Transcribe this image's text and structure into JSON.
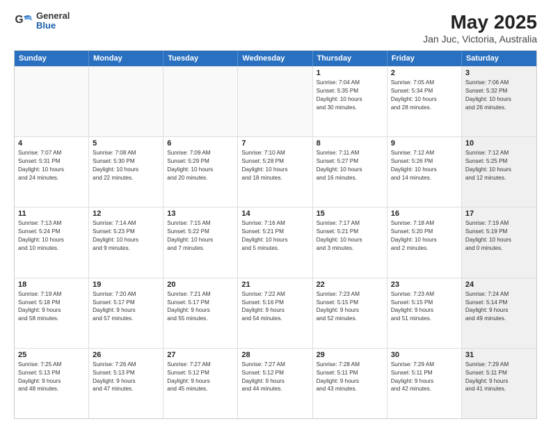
{
  "logo": {
    "general": "General",
    "blue": "Blue"
  },
  "title": "May 2025",
  "subtitle": "Jan Juc, Victoria, Australia",
  "days": [
    "Sunday",
    "Monday",
    "Tuesday",
    "Wednesday",
    "Thursday",
    "Friday",
    "Saturday"
  ],
  "weeks": [
    [
      {
        "day": "",
        "info": "",
        "empty": true
      },
      {
        "day": "",
        "info": "",
        "empty": true
      },
      {
        "day": "",
        "info": "",
        "empty": true
      },
      {
        "day": "",
        "info": "",
        "empty": true
      },
      {
        "day": "1",
        "info": "Sunrise: 7:04 AM\nSunset: 5:35 PM\nDaylight: 10 hours\nand 30 minutes."
      },
      {
        "day": "2",
        "info": "Sunrise: 7:05 AM\nSunset: 5:34 PM\nDaylight: 10 hours\nand 28 minutes."
      },
      {
        "day": "3",
        "info": "Sunrise: 7:06 AM\nSunset: 5:32 PM\nDaylight: 10 hours\nand 26 minutes.",
        "shaded": true
      }
    ],
    [
      {
        "day": "4",
        "info": "Sunrise: 7:07 AM\nSunset: 5:31 PM\nDaylight: 10 hours\nand 24 minutes."
      },
      {
        "day": "5",
        "info": "Sunrise: 7:08 AM\nSunset: 5:30 PM\nDaylight: 10 hours\nand 22 minutes."
      },
      {
        "day": "6",
        "info": "Sunrise: 7:09 AM\nSunset: 5:29 PM\nDaylight: 10 hours\nand 20 minutes."
      },
      {
        "day": "7",
        "info": "Sunrise: 7:10 AM\nSunset: 5:28 PM\nDaylight: 10 hours\nand 18 minutes."
      },
      {
        "day": "8",
        "info": "Sunrise: 7:11 AM\nSunset: 5:27 PM\nDaylight: 10 hours\nand 16 minutes."
      },
      {
        "day": "9",
        "info": "Sunrise: 7:12 AM\nSunset: 5:26 PM\nDaylight: 10 hours\nand 14 minutes."
      },
      {
        "day": "10",
        "info": "Sunrise: 7:12 AM\nSunset: 5:25 PM\nDaylight: 10 hours\nand 12 minutes.",
        "shaded": true
      }
    ],
    [
      {
        "day": "11",
        "info": "Sunrise: 7:13 AM\nSunset: 5:24 PM\nDaylight: 10 hours\nand 10 minutes."
      },
      {
        "day": "12",
        "info": "Sunrise: 7:14 AM\nSunset: 5:23 PM\nDaylight: 10 hours\nand 9 minutes."
      },
      {
        "day": "13",
        "info": "Sunrise: 7:15 AM\nSunset: 5:22 PM\nDaylight: 10 hours\nand 7 minutes."
      },
      {
        "day": "14",
        "info": "Sunrise: 7:16 AM\nSunset: 5:21 PM\nDaylight: 10 hours\nand 5 minutes."
      },
      {
        "day": "15",
        "info": "Sunrise: 7:17 AM\nSunset: 5:21 PM\nDaylight: 10 hours\nand 3 minutes."
      },
      {
        "day": "16",
        "info": "Sunrise: 7:18 AM\nSunset: 5:20 PM\nDaylight: 10 hours\nand 2 minutes."
      },
      {
        "day": "17",
        "info": "Sunrise: 7:19 AM\nSunset: 5:19 PM\nDaylight: 10 hours\nand 0 minutes.",
        "shaded": true
      }
    ],
    [
      {
        "day": "18",
        "info": "Sunrise: 7:19 AM\nSunset: 5:18 PM\nDaylight: 9 hours\nand 58 minutes."
      },
      {
        "day": "19",
        "info": "Sunrise: 7:20 AM\nSunset: 5:17 PM\nDaylight: 9 hours\nand 57 minutes."
      },
      {
        "day": "20",
        "info": "Sunrise: 7:21 AM\nSunset: 5:17 PM\nDaylight: 9 hours\nand 55 minutes."
      },
      {
        "day": "21",
        "info": "Sunrise: 7:22 AM\nSunset: 5:16 PM\nDaylight: 9 hours\nand 54 minutes."
      },
      {
        "day": "22",
        "info": "Sunrise: 7:23 AM\nSunset: 5:15 PM\nDaylight: 9 hours\nand 52 minutes."
      },
      {
        "day": "23",
        "info": "Sunrise: 7:23 AM\nSunset: 5:15 PM\nDaylight: 9 hours\nand 51 minutes."
      },
      {
        "day": "24",
        "info": "Sunrise: 7:24 AM\nSunset: 5:14 PM\nDaylight: 9 hours\nand 49 minutes.",
        "shaded": true
      }
    ],
    [
      {
        "day": "25",
        "info": "Sunrise: 7:25 AM\nSunset: 5:13 PM\nDaylight: 9 hours\nand 48 minutes."
      },
      {
        "day": "26",
        "info": "Sunrise: 7:26 AM\nSunset: 5:13 PM\nDaylight: 9 hours\nand 47 minutes."
      },
      {
        "day": "27",
        "info": "Sunrise: 7:27 AM\nSunset: 5:12 PM\nDaylight: 9 hours\nand 45 minutes."
      },
      {
        "day": "28",
        "info": "Sunrise: 7:27 AM\nSunset: 5:12 PM\nDaylight: 9 hours\nand 44 minutes."
      },
      {
        "day": "29",
        "info": "Sunrise: 7:28 AM\nSunset: 5:11 PM\nDaylight: 9 hours\nand 43 minutes."
      },
      {
        "day": "30",
        "info": "Sunrise: 7:29 AM\nSunset: 5:11 PM\nDaylight: 9 hours\nand 42 minutes."
      },
      {
        "day": "31",
        "info": "Sunrise: 7:29 AM\nSunset: 5:11 PM\nDaylight: 9 hours\nand 41 minutes.",
        "shaded": true
      }
    ]
  ]
}
